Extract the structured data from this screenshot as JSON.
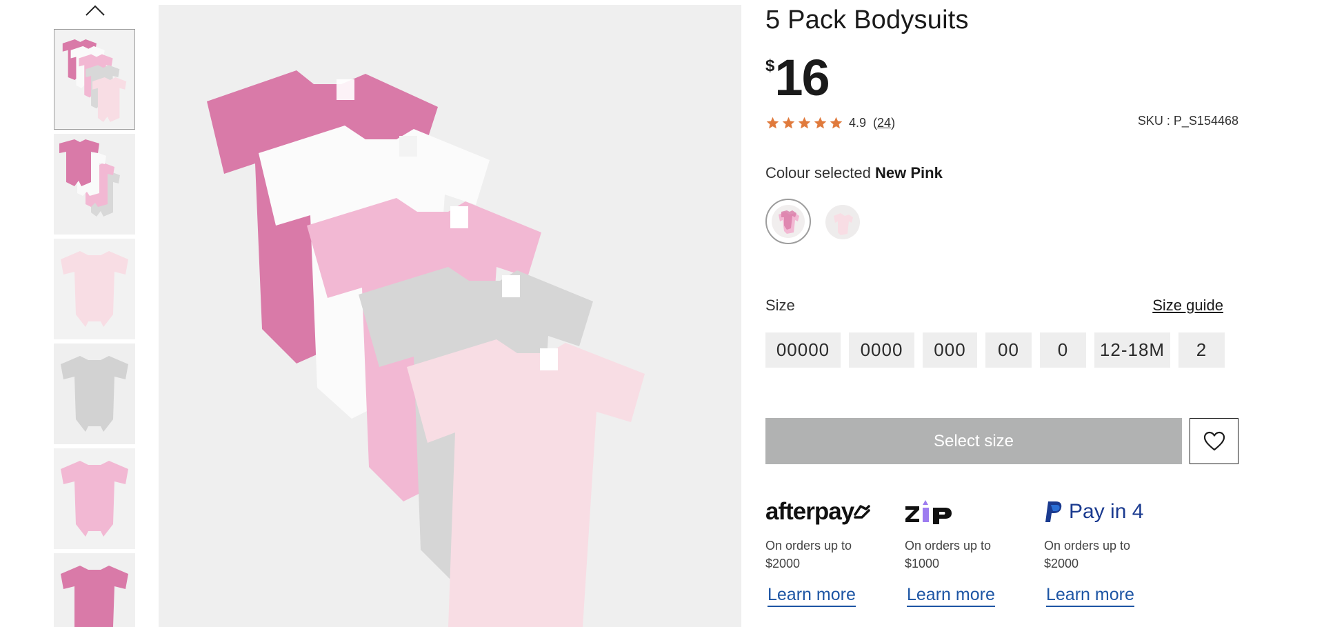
{
  "product": {
    "title": "5 Pack Bodysuits",
    "currency": "$",
    "price": "16",
    "rating": "4.9",
    "rating_stars": 5,
    "review_count_open": "(",
    "review_count": "24",
    "review_count_close": ")",
    "sku": "SKU : P_S154468"
  },
  "colour": {
    "label": "Colour selected",
    "selected": "New Pink",
    "swatches": [
      "New Pink",
      "Light Pink"
    ]
  },
  "size": {
    "label": "Size",
    "guide_label": "Size guide",
    "options": [
      "00000",
      "0000",
      "000",
      "00",
      "0",
      "12-18M",
      "2"
    ]
  },
  "actions": {
    "select_size_label": "Select size",
    "wishlist_icon": "heart-icon"
  },
  "payments": [
    {
      "brand": "afterpay",
      "logo_text": "afterpay",
      "desc_line1": "On orders up to",
      "desc_line2": "$2000",
      "link": "Learn more"
    },
    {
      "brand": "zip",
      "logo_text": "zip",
      "desc_line1": "On orders up to",
      "desc_line2": "$1000",
      "link": "Learn more"
    },
    {
      "brand": "paypal",
      "logo_text": "Pay in 4",
      "desc_line1": "On orders up to",
      "desc_line2": "$2000",
      "link": "Learn more"
    }
  ],
  "gallery": {
    "thumb_count": 6,
    "selected_index": 0,
    "up_icon": "chevron-up-icon"
  },
  "colors": {
    "star": "#e07a3c",
    "link": "#1d55a4",
    "button_disabled": "#b1b2b2",
    "pink_dark": "#d97aa8",
    "pink_mid": "#f2b8d3",
    "pink_light": "#f8dde4",
    "grey": "#d6d6d6"
  }
}
